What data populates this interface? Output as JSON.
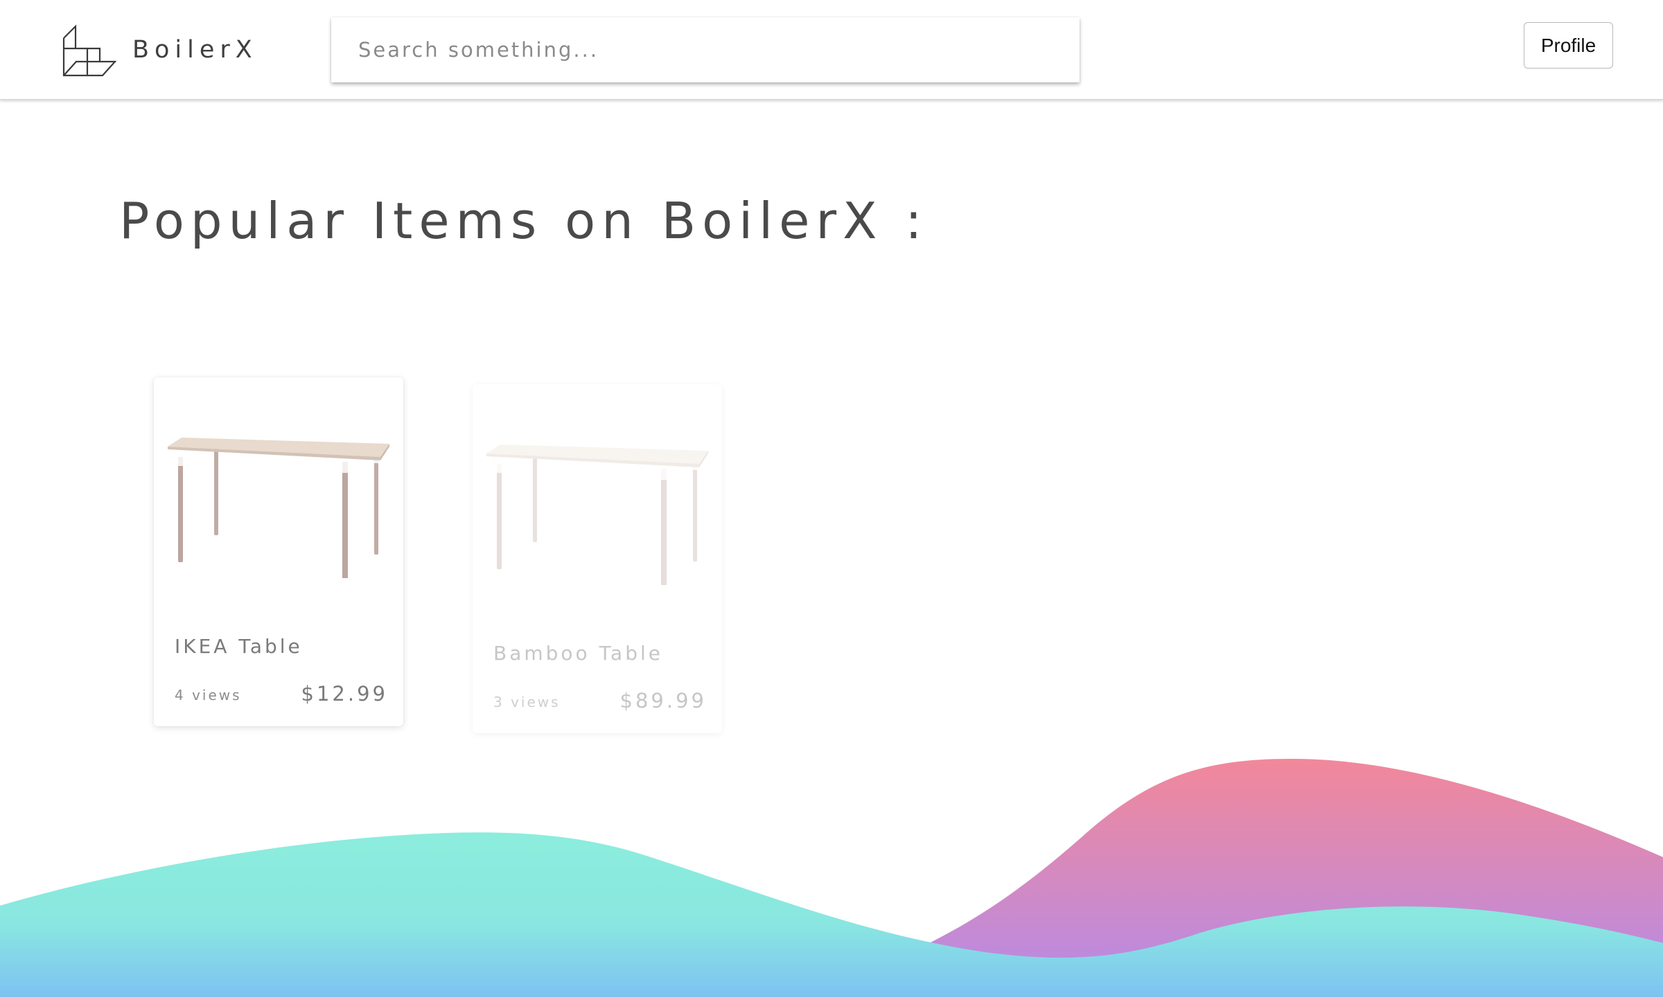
{
  "header": {
    "brand": "BoilerX",
    "logo_icon": "cube-outline-icon",
    "search_placeholder": "Search something...",
    "search_value": "",
    "profile_label": "Profile"
  },
  "main": {
    "title": "Popular Items on BoilerX :",
    "items": [
      {
        "name": "IKEA Table",
        "views": "4 views",
        "price": "$12.99",
        "image_icon": "table-image"
      },
      {
        "name": "Bamboo Table",
        "views": "3 views",
        "price": "$89.99",
        "image_icon": "table-image"
      }
    ]
  },
  "colors": {
    "wave_teal_top": "#8ce9de",
    "wave_blue_bottom": "#80c3f1",
    "wave_pink_top": "#f0889a",
    "wave_purple_bottom": "#b58ae8",
    "table_top": "#e6d8cc",
    "table_leg": "#bfaba5"
  }
}
